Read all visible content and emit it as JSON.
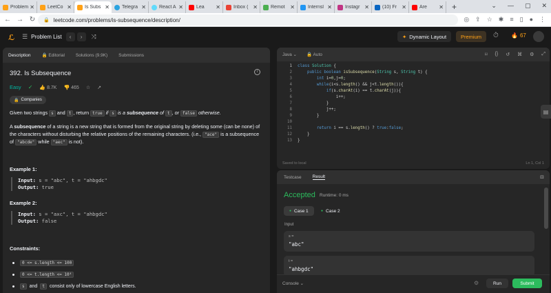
{
  "browser": {
    "tabs": [
      {
        "title": "Problem",
        "color": "#ffa116"
      },
      {
        "title": "LeetCo",
        "color": "#ffa116"
      },
      {
        "title": "Is Subs",
        "color": "#ffa116",
        "active": true
      },
      {
        "title": "Telegra",
        "color": "#2aa3e0"
      },
      {
        "title": "React A",
        "color": "#61dafb"
      },
      {
        "title": "Lea",
        "color": "#ff0000"
      },
      {
        "title": "Inbox (",
        "color": "#ea4335"
      },
      {
        "title": "Remot",
        "color": "#4caf50"
      },
      {
        "title": "Internsl",
        "color": "#2196f3"
      },
      {
        "title": "Instagr",
        "color": "#c13584"
      },
      {
        "title": "(10) Fr",
        "color": "#0a66c2"
      },
      {
        "title": "Are",
        "color": "#ff0000"
      }
    ],
    "new_tab": "+",
    "url": "leetcode.com/problems/is-subsequence/description/",
    "window_controls": [
      "⌄",
      "—",
      "▢",
      "✕"
    ]
  },
  "nav": {
    "logo": "ℒ",
    "problem_list": "Problem List",
    "dynamic_layout": "Dynamic Layout",
    "premium": "Premium",
    "streak": "67"
  },
  "left": {
    "tabs": [
      "Description",
      "Editorial",
      "Solutions (9.9K)",
      "Submissions"
    ],
    "title": "392. Is Subsequence",
    "difficulty": "Easy",
    "likes": "8.7K",
    "dislikes": "465",
    "companies": "Companies",
    "desc1": {
      "a": "Given two strings ",
      "s": "s",
      "b": " and ",
      "t": "t",
      "c": ", return ",
      "true": "true",
      "d": " if ",
      "s2": "s",
      "e": " is a ",
      "sub": "subsequence",
      "f": " of ",
      "t2": "t",
      "g": ", or ",
      "false": "false",
      "h": " otherwise."
    },
    "desc2": {
      "a": "A ",
      "sub": "subsequence",
      "b": " of a string is a new string that is formed from the original string by deleting some (can be none) of the characters without disturbing the relative positions of the remaining characters. (i.e., ",
      "ace": "\"ace\"",
      "c": " is a subsequence of ",
      "abcde": "\"abcde\"",
      "d": " while ",
      "aec": "\"aec\"",
      "e": " is not)."
    },
    "ex1": {
      "h": "Example 1:",
      "in_k": "Input:",
      "in_v": " s = \"abc\", t = \"ahbgdc\"",
      "out_k": "Output:",
      "out_v": " true"
    },
    "ex2": {
      "h": "Example 2:",
      "in_k": "Input:",
      "in_v": " s = \"axc\", t = \"ahbgdc\"",
      "out_k": "Output:",
      "out_v": " false"
    },
    "constraints_h": "Constraints:",
    "constraints": [
      {
        "code": "0 <= s.length <= 100",
        "after": ""
      },
      {
        "code": "0 <= t.length <= 10⁴",
        "after": ""
      },
      {
        "code": "s",
        "mid": " and ",
        "code2": "t",
        "after": " consist only of lowercase English letters."
      }
    ]
  },
  "editor": {
    "language": "Java",
    "auto": "Auto",
    "saved": "Saved to local",
    "lncol": "Ln 1, Col 1",
    "lines": [
      "class Solution {",
      "    public boolean isSubsequence(String s, String t) {",
      "        int i=0,j=0;",
      "        while(i<s.length() && j<t.length()){",
      "            if(s.charAt(i) == t.charAt(j)){",
      "                i++;",
      "            }",
      "            j++;",
      "        }",
      "",
      "        return i == s.length() ? true:false;",
      "    }",
      "}"
    ]
  },
  "testcase": {
    "tabs": [
      "Testcase",
      "Result"
    ],
    "status": "Accepted",
    "runtime": "Runtime: 0 ms",
    "cases": [
      "Case 1",
      "Case 2"
    ],
    "input_label": "Input",
    "inputs": [
      {
        "name": "s =",
        "value": "\"abc\""
      },
      {
        "name": "t =",
        "value": "\"ahbgdc\""
      }
    ],
    "console": "Console",
    "run": "Run",
    "submit": "Submit"
  }
}
